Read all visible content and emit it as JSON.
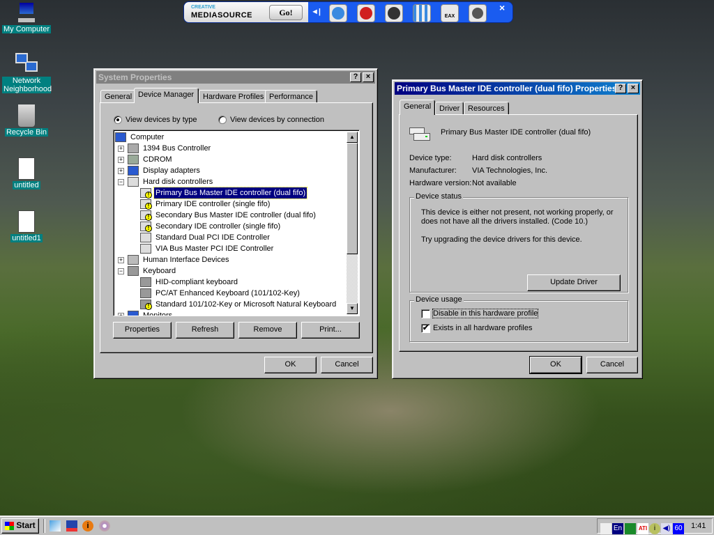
{
  "desktop_icons": [
    {
      "label": "My Computer",
      "icon": "computer-icon"
    },
    {
      "label": "Network Neighborhood",
      "icon": "network-icon"
    },
    {
      "label": "Recycle Bin",
      "icon": "recycle-bin-icon"
    },
    {
      "label": "untitled",
      "icon": "paint-document-icon"
    },
    {
      "label": "untitled1",
      "icon": "paint-document-icon"
    }
  ],
  "mediasource": {
    "brand_top": "CREATIVE",
    "brand": "MEDIASOURCE",
    "go": "Go!",
    "close": "×",
    "accent": "#1a5cf0",
    "buttons": [
      "collapse",
      "play",
      "radio",
      "speaker",
      "mixer",
      "EAX",
      "surround"
    ]
  },
  "system_properties": {
    "title": "System Properties",
    "help": "?",
    "close": "×",
    "tabs": [
      "General",
      "Device Manager",
      "Hardware Profiles",
      "Performance"
    ],
    "active_tab": 1,
    "radio_by_type": "View devices by type",
    "radio_by_connection": "View devices by connection",
    "selected_view": "type",
    "tree": [
      {
        "level": 0,
        "label": "Computer",
        "icon": "computer-icon"
      },
      {
        "level": 1,
        "label": "1394 Bus Controller",
        "exp": "+",
        "icon": "bus-controller-icon"
      },
      {
        "level": 1,
        "label": "CDROM",
        "exp": "+",
        "icon": "cdrom-icon"
      },
      {
        "level": 1,
        "label": "Display adapters",
        "exp": "+",
        "icon": "monitor-icon"
      },
      {
        "level": 1,
        "label": "Hard disk controllers",
        "exp": "−",
        "icon": "disk-controller-icon"
      },
      {
        "level": 2,
        "label": "Primary Bus Master IDE controller (dual fifo)",
        "icon": "disk-controller-icon",
        "warn": true,
        "selected": true
      },
      {
        "level": 2,
        "label": "Primary IDE controller (single fifo)",
        "icon": "disk-controller-icon",
        "warn": true
      },
      {
        "level": 2,
        "label": "Secondary Bus Master IDE controller (dual fifo)",
        "icon": "disk-controller-icon",
        "warn": true
      },
      {
        "level": 2,
        "label": "Secondary IDE controller (single fifo)",
        "icon": "disk-controller-icon",
        "warn": true
      },
      {
        "level": 2,
        "label": "Standard Dual PCI IDE Controller",
        "icon": "disk-controller-icon"
      },
      {
        "level": 2,
        "label": "VIA Bus Master PCI IDE Controller",
        "icon": "disk-controller-icon"
      },
      {
        "level": 1,
        "label": "Human Interface Devices",
        "exp": "+",
        "icon": "hid-icon"
      },
      {
        "level": 1,
        "label": "Keyboard",
        "exp": "−",
        "icon": "keyboard-icon"
      },
      {
        "level": 2,
        "label": "HID-compliant keyboard",
        "icon": "keyboard-icon"
      },
      {
        "level": 2,
        "label": "PC/AT Enhanced Keyboard (101/102-Key)",
        "icon": "keyboard-icon"
      },
      {
        "level": 2,
        "label": "Standard 101/102-Key or Microsoft Natural Keyboard",
        "icon": "keyboard-icon",
        "warn": true
      },
      {
        "level": 1,
        "label": "Monitors",
        "exp": "+",
        "icon": "monitor-icon"
      }
    ],
    "scroll_position": 0.0,
    "buttons": {
      "properties": "Properties",
      "refresh": "Refresh",
      "remove": "Remove",
      "print": "Print...",
      "ok": "OK",
      "cancel": "Cancel"
    }
  },
  "device_properties": {
    "title": "Primary Bus Master IDE controller (dual fifo) Properties",
    "help": "?",
    "close": "×",
    "tabs": [
      "General",
      "Driver",
      "Resources"
    ],
    "active_tab": 0,
    "device_name": "Primary Bus Master IDE controller (dual fifo)",
    "fields": [
      {
        "label": "Device type:",
        "value": "Hard disk controllers"
      },
      {
        "label": "Manufacturer:",
        "value": "VIA Technologies, Inc."
      },
      {
        "label": "Hardware version:",
        "value": "Not available"
      }
    ],
    "status_group": "Device status",
    "status_line1": "This device is either not present, not working properly, or",
    "status_line2": "does not have all the drivers installed.  (Code 10.)",
    "status_line3": "Try upgrading the device drivers for this device.",
    "update_driver": "Update Driver",
    "usage_group": "Device usage",
    "disable_label": "Disable in this hardware profile",
    "disable_checked": false,
    "exists_label": "Exists in all hardware profiles",
    "exists_checked": true,
    "check": "✔",
    "ok": "OK",
    "cancel": "Cancel"
  },
  "taskbar": {
    "start": "Start",
    "quick_launch": [
      "notepad",
      "save",
      "info",
      "cd-player"
    ],
    "tray": {
      "lang": "En",
      "volume_badge": "60",
      "ati": "ATI",
      "clock": "1:41"
    }
  }
}
